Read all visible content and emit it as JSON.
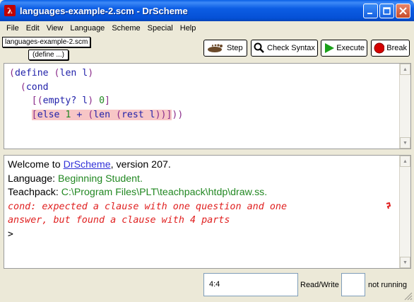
{
  "window": {
    "title": "languages-example-2.scm - DrScheme",
    "app_icon_glyph": "λ",
    "controls": [
      "minimize",
      "maximize",
      "close"
    ]
  },
  "menu": [
    "File",
    "Edit",
    "View",
    "Language",
    "Scheme",
    "Special",
    "Help"
  ],
  "toolbar": {
    "file_name": "languages-example-2.scm",
    "define_menu": "(define ...)",
    "step_label": "Step",
    "check_syntax_label": "Check Syntax",
    "execute_label": "Execute",
    "break_label": "Break"
  },
  "definitions": {
    "lines": [
      "(define (len l)",
      "  (cond",
      "    [(empty? l) 0]",
      "    [else 1 + (len (rest l))]))"
    ]
  },
  "interactions": {
    "welcome_prefix": "Welcome to ",
    "welcome_link": "DrScheme",
    "welcome_suffix": ", version 207.",
    "language_label": "Language: ",
    "language_value": "Beginning Student.",
    "teachpack_label": "Teachpack: ",
    "teachpack_value": "C:\\Program Files\\PLT\\teachpack\\htdp\\draw.ss.",
    "error_line1": "cond: expected a clause with one question and one",
    "error_line2": "answer, but found a clause with 4 parts",
    "prompt": ">"
  },
  "status": {
    "position": "4:4",
    "mode": "Read/Write",
    "running": "not running"
  },
  "colors": {
    "keyword": "#2222aa",
    "bracket": "#8a2b8a",
    "number": "#228822",
    "error": "#e02020",
    "highlight": "#f7c6c6"
  }
}
